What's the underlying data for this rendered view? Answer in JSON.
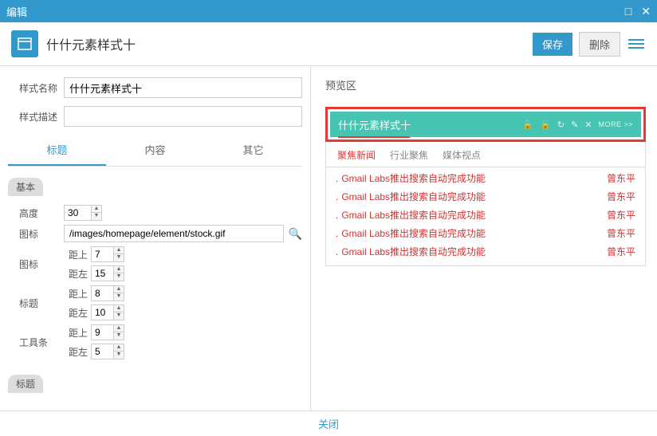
{
  "window": {
    "title": "编辑"
  },
  "header": {
    "title": "什什元素样式十",
    "save": "保存",
    "delete": "删除"
  },
  "form": {
    "styleNameLabel": "样式名称",
    "styleNameValue": "什什元素样式十",
    "styleDescLabel": "样式描述",
    "styleDescValue": ""
  },
  "tabs": {
    "t0": "标题",
    "t1": "内容",
    "t2": "其它"
  },
  "section": {
    "basic": "基本",
    "title": "标题"
  },
  "props": {
    "heightLabel": "高度",
    "heightValue": "30",
    "iconLabel": "图标",
    "iconValue": "/images/homepage/element/stock.gif",
    "iconLabel2": "图标",
    "titleLabel": "标题",
    "toolbarLabel": "工具条",
    "marginTop": "距上",
    "mt1": "7",
    "mt2": "8",
    "mt3": "9",
    "marginLeft": "距左",
    "ml1": "15",
    "ml2": "10",
    "ml3": "5"
  },
  "preview": {
    "areaTitle": "预览区",
    "boxTitle": "什什元素样式十",
    "more": "MORE >>",
    "tabs": {
      "p0": "聚焦新闻",
      "p1": "行业聚焦",
      "p2": "媒体视点"
    },
    "items": [
      {
        "text": "Gmail Labs推出搜索自动完成功能",
        "author": "曾东平"
      },
      {
        "text": "Gmail Labs推出搜索自动完成功能",
        "author": "曾东平"
      },
      {
        "text": "Gmail Labs推出搜索自动完成功能",
        "author": "曾东平"
      },
      {
        "text": "Gmail Labs推出搜索自动完成功能",
        "author": "曾东平"
      },
      {
        "text": "Gmail Labs推出搜索自动完成功能",
        "author": "曾东平"
      }
    ]
  },
  "footer": {
    "close": "关闭"
  }
}
